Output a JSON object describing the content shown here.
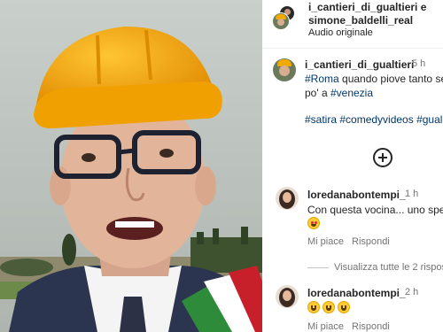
{
  "header": {
    "usernames_line1": "i_cantieri_di_gualtieri e",
    "usernames_line2": "simone_baldelli_real",
    "audio": "Audio originale"
  },
  "caption": {
    "username": "i_cantieri_di_gualtieri",
    "time": "5 h",
    "line1_tag": "#Roma",
    "line1_text": " quando piove tanto se",
    "line2_text": "po' a ",
    "line2_tag": "#venezia",
    "hashtags": "#satira #comedyvideos #gual"
  },
  "comments": [
    {
      "username": "loredanabontempi_",
      "time": "1 h",
      "text": "Con questa vocina... uno spe",
      "likes_label": "Mi piace",
      "reply_label": "Rispondi"
    },
    {
      "username": "loredanabontempi_",
      "time": "2 h",
      "likes_label": "Mi piace",
      "reply_label": "Rispondi"
    }
  ],
  "view_replies": "Visualizza tutte le 2 rispost",
  "icons": {
    "add": "plus-circle-icon",
    "emoji_heart_eyes": "heart-eyes-emoji",
    "emoji_grin": "grinning-emoji"
  },
  "colors": {
    "hashtag": "#00376b",
    "muted": "#737373",
    "helmet": "#f2a900"
  }
}
